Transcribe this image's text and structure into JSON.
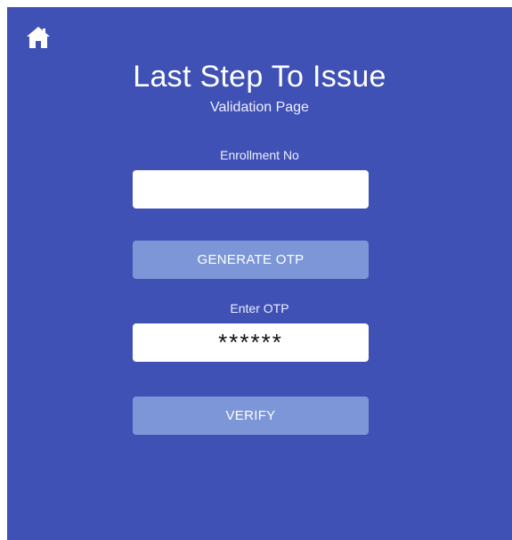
{
  "page": {
    "title": "Last Step To Issue",
    "subtitle": "Validation Page"
  },
  "nav": {
    "home_icon": "home-icon"
  },
  "form": {
    "enrollment": {
      "label": "Enrollment No",
      "value": "",
      "placeholder": ""
    },
    "generate_button": "GENERATE OTP",
    "otp": {
      "label": "Enter OTP",
      "value": "",
      "placeholder": "******"
    },
    "verify_button": "VERIFY"
  },
  "colors": {
    "background": "#3f51b5",
    "button": "#7c96d8",
    "text": "#ffffff"
  }
}
